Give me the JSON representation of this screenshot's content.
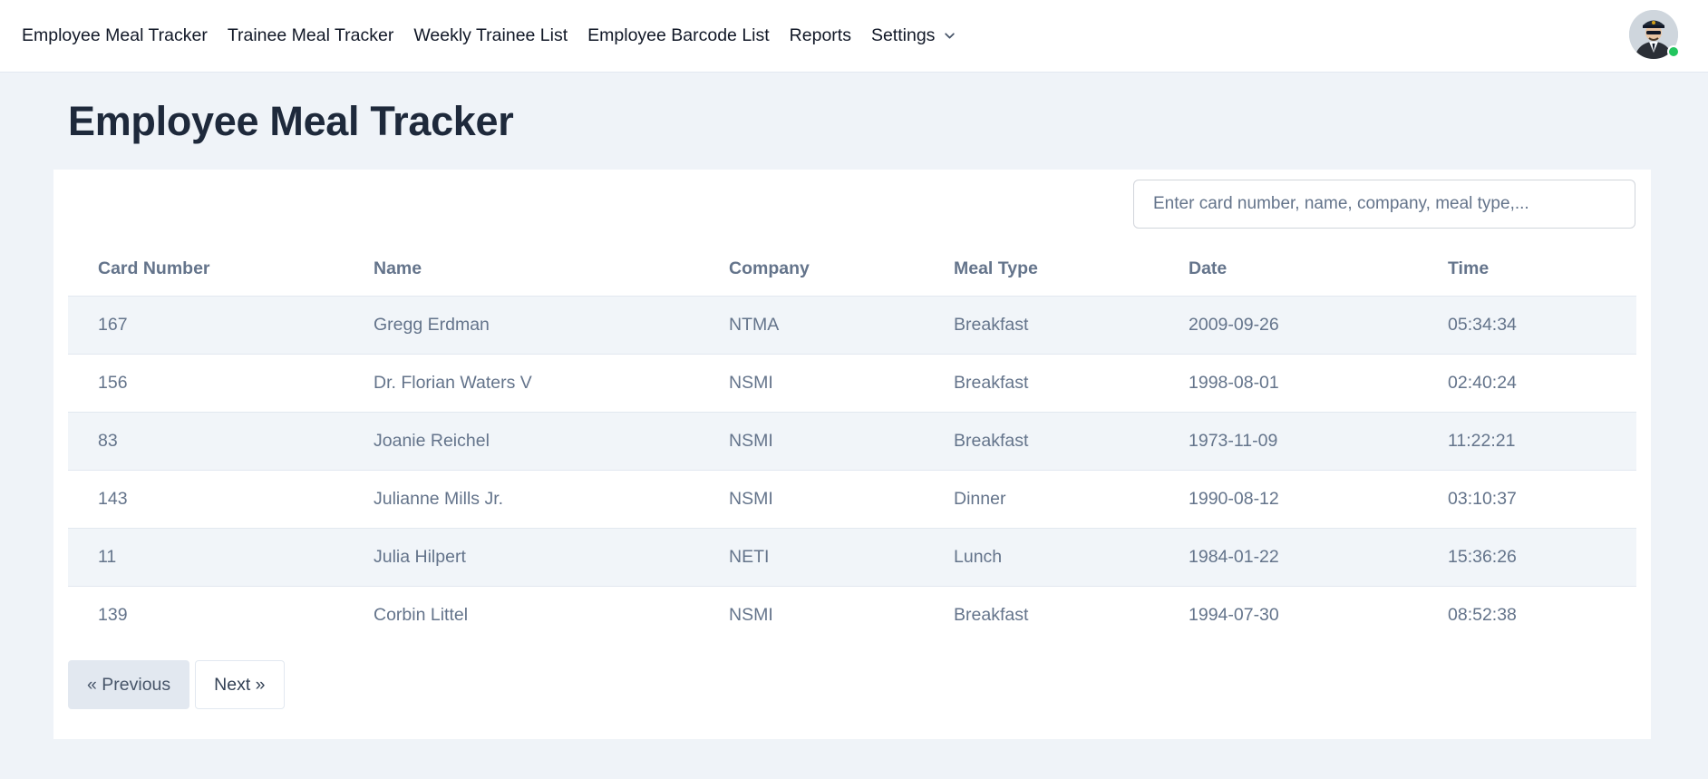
{
  "nav": {
    "items": [
      {
        "label": "Employee Meal Tracker"
      },
      {
        "label": "Trainee Meal Tracker"
      },
      {
        "label": "Weekly Trainee List"
      },
      {
        "label": "Employee Barcode List"
      },
      {
        "label": "Reports"
      },
      {
        "label": "Settings"
      }
    ],
    "status_color": "#22c55e"
  },
  "page": {
    "title": "Employee Meal Tracker"
  },
  "search": {
    "placeholder": "Enter card number, name, company, meal type,..."
  },
  "table": {
    "headers": [
      "Card Number",
      "Name",
      "Company",
      "Meal Type",
      "Date",
      "Time"
    ],
    "rows": [
      [
        "167",
        "Gregg Erdman",
        "NTMA",
        "Breakfast",
        "2009-09-26",
        "05:34:34"
      ],
      [
        "156",
        "Dr. Florian Waters V",
        "NSMI",
        "Breakfast",
        "1998-08-01",
        "02:40:24"
      ],
      [
        "83",
        "Joanie Reichel",
        "NSMI",
        "Breakfast",
        "1973-11-09",
        "11:22:21"
      ],
      [
        "143",
        "Julianne Mills Jr.",
        "NSMI",
        "Dinner",
        "1990-08-12",
        "03:10:37"
      ],
      [
        "11",
        "Julia Hilpert",
        "NETI",
        "Lunch",
        "1984-01-22",
        "15:36:26"
      ],
      [
        "139",
        "Corbin Littel",
        "NSMI",
        "Breakfast",
        "1994-07-30",
        "08:52:38"
      ]
    ]
  },
  "pagination": {
    "prev_label": "« Previous",
    "next_label": "Next »"
  },
  "colors": {
    "background": "#eff3f8",
    "row_stripe": "#f1f5f9",
    "text_muted": "#64748b"
  }
}
